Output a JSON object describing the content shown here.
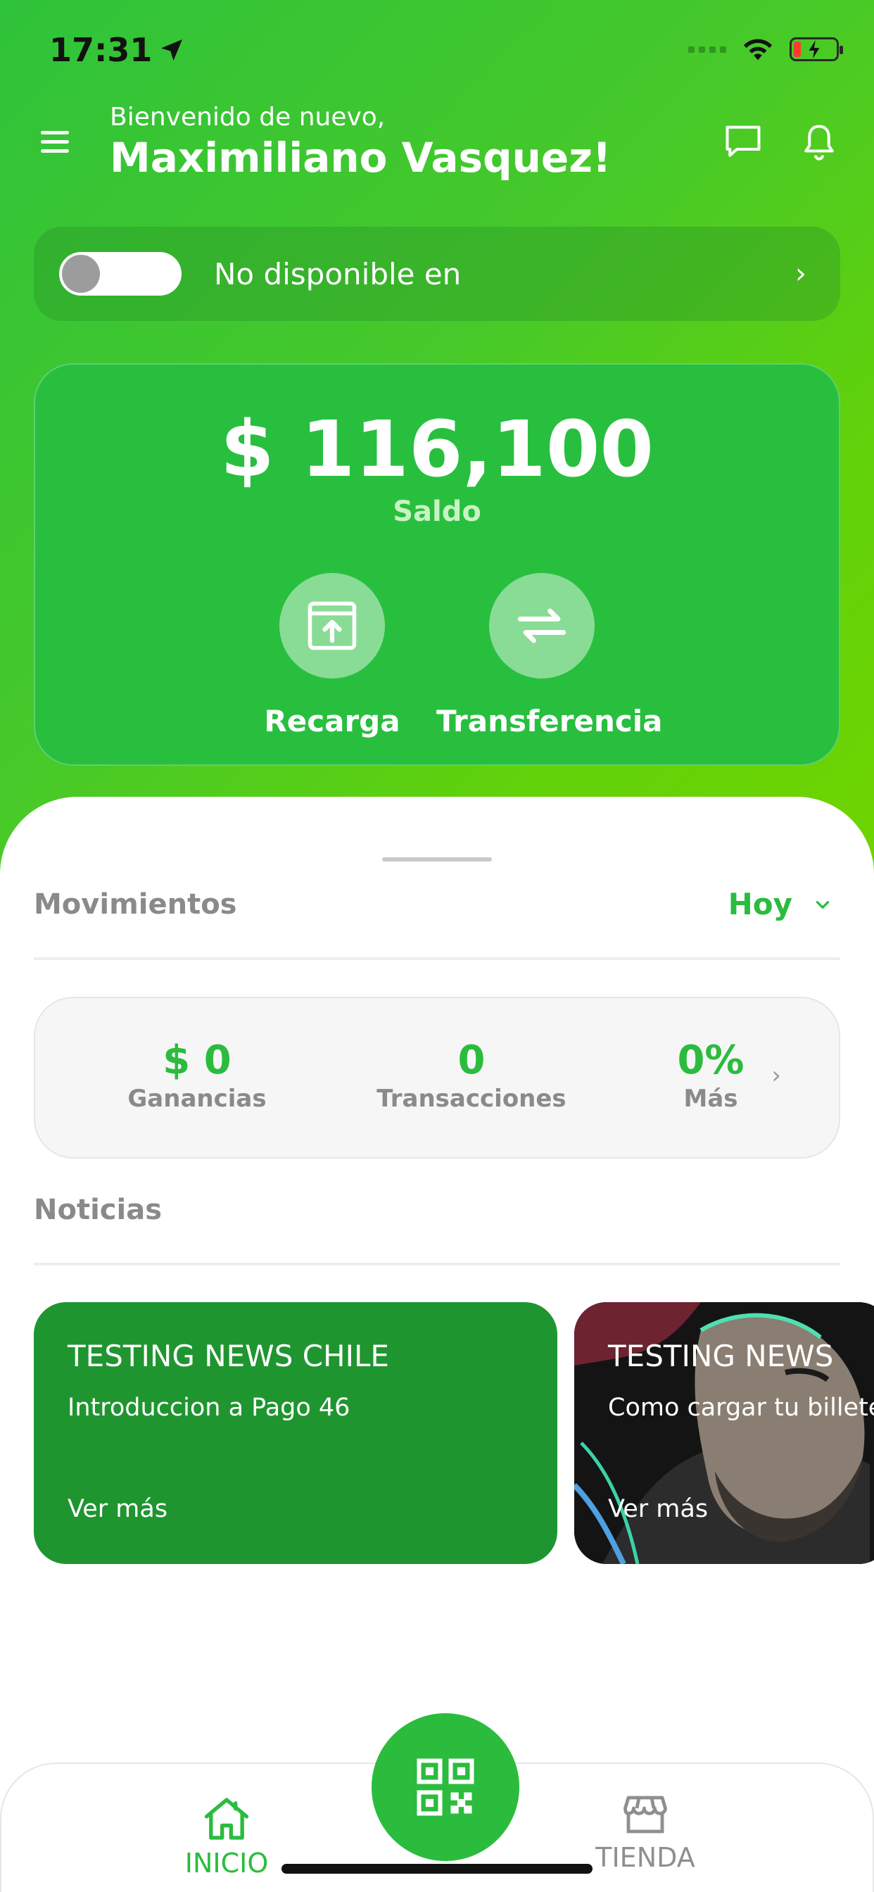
{
  "status_bar": {
    "time": "17:31"
  },
  "header": {
    "welcome": "Bienvenido de nuevo,",
    "name": "Maximiliano Vasquez!"
  },
  "availability": {
    "label": "No disponible en",
    "enabled": false
  },
  "balance": {
    "amount": "$ 116,100",
    "label": "Saldo",
    "actions": [
      {
        "label": "Recarga"
      },
      {
        "label": "Transferencia"
      }
    ]
  },
  "movements": {
    "title": "Movimientos",
    "period": "Hoy",
    "stats": [
      {
        "value": "$ 0",
        "label": "Ganancias"
      },
      {
        "value": "0",
        "label": "Transacciones"
      },
      {
        "value": "0%",
        "label": "Más"
      }
    ]
  },
  "news": {
    "title": "Noticias",
    "items": [
      {
        "title": "TESTING NEWS CHILE",
        "description": "Introduccion a Pago 46",
        "link": "Ver más"
      },
      {
        "title": "TESTING NEWS",
        "description": "Como cargar tu billetera",
        "link": "Ver más"
      }
    ]
  },
  "tabbar": {
    "tabs": [
      {
        "label": "INICIO",
        "active": true
      },
      {
        "label": "TIENDA",
        "active": false
      }
    ]
  },
  "colors": {
    "primary": "#2bbc3e",
    "accent_light": "#6fd400",
    "muted_text": "#8a8a8a"
  }
}
